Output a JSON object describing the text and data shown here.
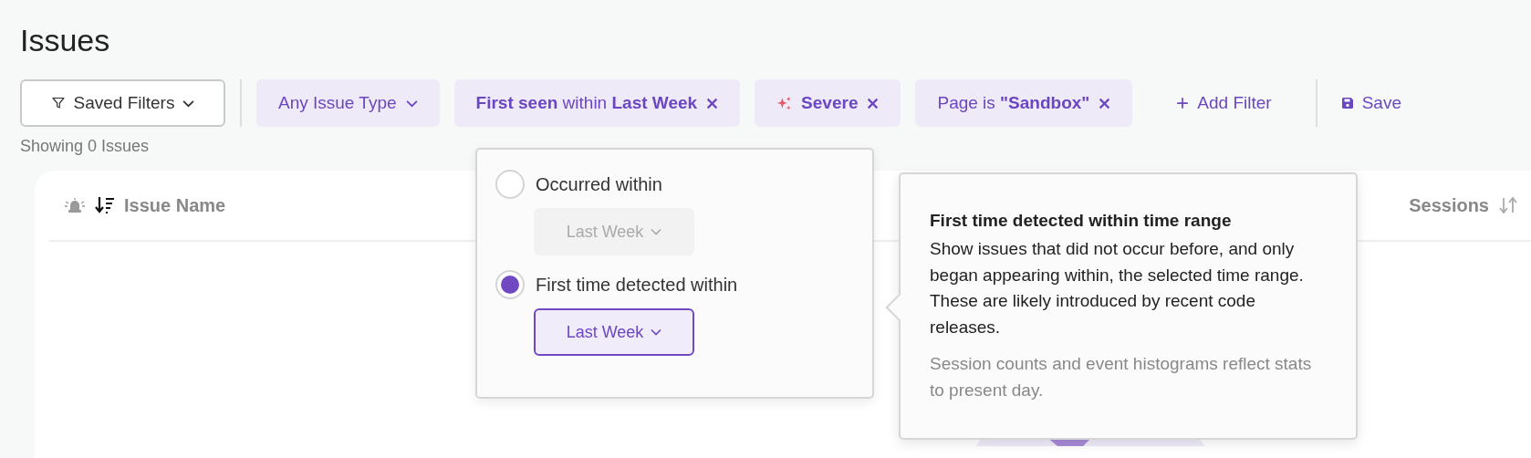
{
  "page": {
    "title": "Issues"
  },
  "toolbar": {
    "saved_filters": "Saved Filters",
    "filters": [
      {
        "kind": "dropdown",
        "text": "Any Issue Type"
      },
      {
        "kind": "removable",
        "text": "**First seen** within **Last Week**"
      },
      {
        "kind": "severity",
        "text": "Severe"
      },
      {
        "kind": "removable",
        "text": "Page is **\"Sandbox\"**"
      }
    ],
    "add_filter": "Add Filter",
    "save": "Save"
  },
  "result_count": "Showing 0 Issues",
  "table": {
    "columns": [
      {
        "kind": "name",
        "label": "Issue Name"
      },
      {
        "kind": "sessions",
        "label": "Sessions"
      }
    ]
  },
  "popover": {
    "options": [
      {
        "label": "Occurred within",
        "selected": false,
        "range": "Last Week"
      },
      {
        "label": "First time detected within",
        "selected": true,
        "range": "Last Week"
      }
    ]
  },
  "tooltip": {
    "title": "First time detected within time range",
    "body": "Show issues that did not occur before, and only began appearing within, the selected time range. These are likely introduced by recent code releases.",
    "note": "Session counts and event histograms reflect stats to present day."
  }
}
